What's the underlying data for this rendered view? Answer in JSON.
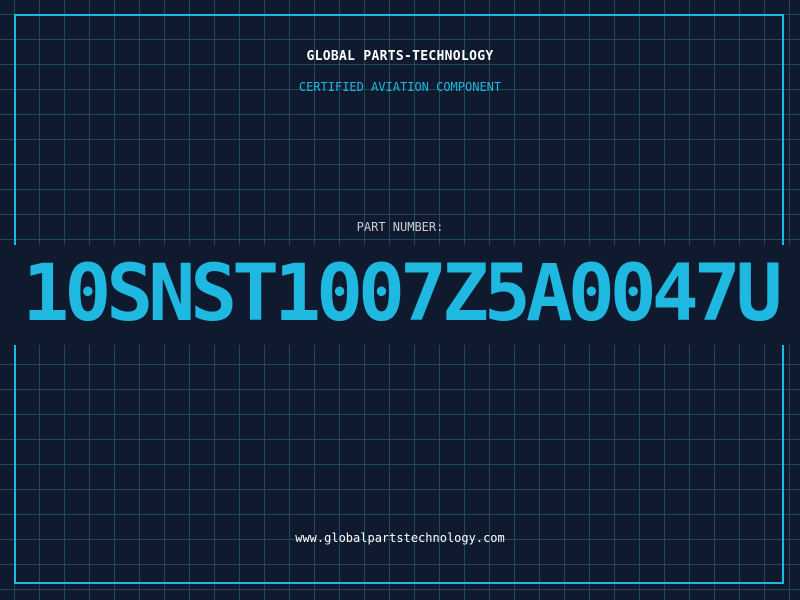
{
  "label": {
    "company": "GLOBAL PARTS-TECHNOLOGY",
    "subtitle": "CERTIFIED AVIATION COMPONENT",
    "part_number_label": "PART NUMBER:",
    "part_number": "10SNST1007Z5A0047U",
    "website": "www.globalpartstechnology.com"
  },
  "colors": {
    "background": "#0f1a2e",
    "grid": "#1e4a5c",
    "accent": "#1fb8e0",
    "text": "#ffffff"
  }
}
